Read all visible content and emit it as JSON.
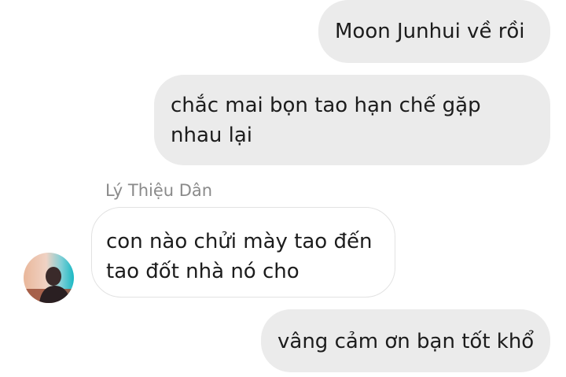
{
  "messages": [
    {
      "direction": "outgoing",
      "text": "Moon Junhui về rồi"
    },
    {
      "direction": "outgoing",
      "lines": [
        "chắc mai bọn tao hạn chế gặp",
        "nhau lại"
      ]
    },
    {
      "direction": "incoming",
      "sender": "Lý Thiệu Dân",
      "lines": [
        "con nào chửi mày tao đến",
        "tao đốt nhà nó cho"
      ]
    },
    {
      "direction": "outgoing",
      "text": "vâng cảm ơn bạn tốt khổ"
    }
  ],
  "colors": {
    "outgoing_bubble": "#ebebeb",
    "incoming_bubble": "#ffffff",
    "incoming_border": "#e2e2e2",
    "sender_name": "#8a8a8a",
    "text": "#1c1c1c"
  },
  "icons": {
    "avatar": "sender-avatar-photo"
  }
}
